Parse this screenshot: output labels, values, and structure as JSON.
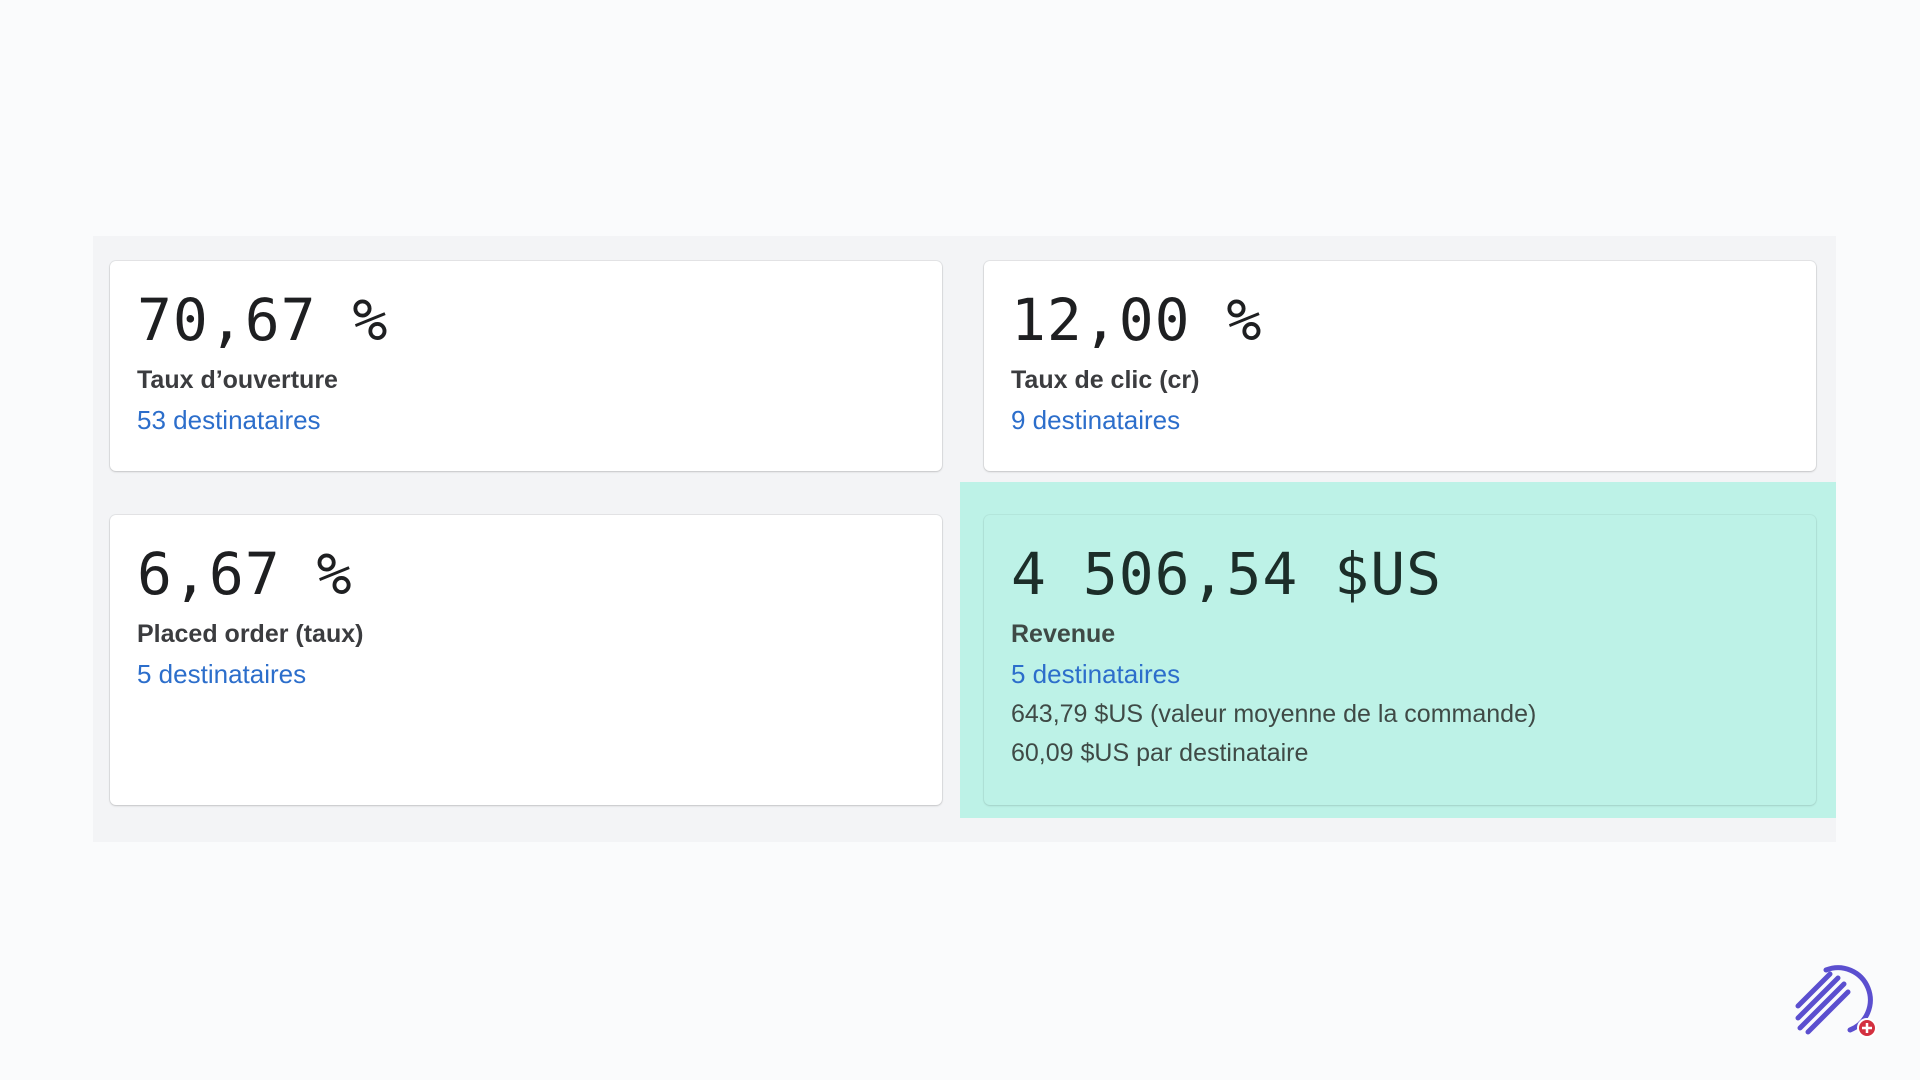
{
  "cards": [
    {
      "metric": "70,67 %",
      "label": "Taux d’ouverture",
      "link": "53 destinataires"
    },
    {
      "metric": "12,00 %",
      "label": "Taux de clic (cr)",
      "link": "9 destinataires"
    },
    {
      "metric": "6,67 %",
      "label": "Placed order (taux)",
      "link": "5 destinataires"
    },
    {
      "metric": "4 506,54 $US",
      "label": "Revenue",
      "link": "5 destinataires",
      "details": [
        "643,79 $US (valeur moyenne de la commande)",
        "60,09 $US par destinataire"
      ]
    }
  ],
  "colors": {
    "background": "#fafbfc",
    "panel": "#f3f4f6",
    "highlight": "#bdf2e7",
    "link": "#2c6ecb",
    "logo": "#5b4fcf",
    "logo_badge": "#d3303f"
  },
  "icons": {
    "brand_logo": "striped-circle-logo-icon"
  }
}
